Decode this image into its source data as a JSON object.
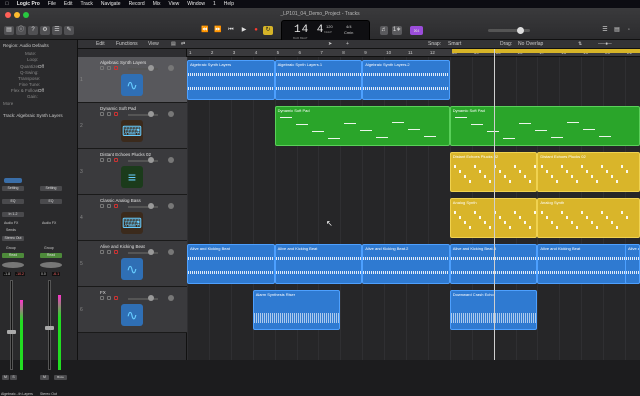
{
  "menubar": {
    "apple": "",
    "app": "Logic Pro",
    "items": [
      "File",
      "Edit",
      "Track",
      "Navigate",
      "Record",
      "Mix",
      "View",
      "Window",
      "1",
      "Help"
    ]
  },
  "window": {
    "title": "_LP101_04_Demo_Project - Tracks"
  },
  "lcd": {
    "position": "14 4",
    "position_label": "BAR  BEAT",
    "tempo": "120",
    "tempo_label": "KEEP",
    "sig": "4/4",
    "key": "Cmin"
  },
  "badge": "☒4",
  "toolbar2": {
    "edit": "Edit",
    "functions": "Functions",
    "view": "View",
    "snap_label": "Snap:",
    "snap": "Smart",
    "drag_label": "Drag:",
    "drag": "No Overlap"
  },
  "ruler": [
    "1",
    "2",
    "3",
    "4",
    "5",
    "6",
    "7",
    "8",
    "9",
    "10",
    "11",
    "12",
    "13",
    "14",
    "15",
    "16",
    "17",
    "18",
    "19",
    "20",
    "21"
  ],
  "inspector": {
    "region": "Region: Audio Defaults",
    "track": "Track: Algebraic Synth Layers",
    "fields": [
      "Mute:",
      "Loop:",
      "Quantize:",
      "Q-Swing:",
      "Transpose:",
      "Fine Tune:",
      "Flex & Follow:",
      "Gain:"
    ],
    "quantize_val": "Off",
    "flex_val": "Off",
    "more": "More"
  },
  "channel": {
    "setting": "Setting",
    "eq": "EQ",
    "input": "In 1-2",
    "audiofx": "Audio FX",
    "sends": "Sends",
    "output": "Stereo Out",
    "group": "Group",
    "read": "Read",
    "vol_left": "-1.8",
    "vol_left2": "-10.2",
    "vol_right": "0.0",
    "vol_right2": "-6.1",
    "name_left": "Algebraic...th Layers",
    "name_right": "Stereo Out",
    "bnce": "Bnce",
    "m": "M",
    "s": "S",
    "r": "R",
    "i": "I"
  },
  "tracks": [
    {
      "num": "1",
      "name": "Algebraic Synth Layers"
    },
    {
      "num": "2",
      "name": "Dynamic Soft Pad"
    },
    {
      "num": "3",
      "name": "Distant Echoes Plucks 02"
    },
    {
      "num": "4",
      "name": "Classic Analog Bass"
    },
    {
      "num": "5",
      "name": "Alive and Kicking Beat"
    },
    {
      "num": "6",
      "name": "FX"
    }
  ],
  "regions": {
    "t1": [
      "Algebraic Synth Layers",
      "Algebraic Synth Layers.1",
      "Algebraic Synth Layers.2"
    ],
    "t2": [
      "Dynamic Soft Pad",
      "Dynamic Soft Pad"
    ],
    "t3": [
      "Distant Echoes Plucks 02",
      "Distant Echoes Plucks 02"
    ],
    "t4": [
      "Analog Synth",
      "Analog Synth"
    ],
    "t5": [
      "Alive and Kicking Beat",
      "Alive and Kicking Beat",
      "Alive and Kicking Beat.2",
      "Alive and Kicking Beat.3",
      "Alive and Kicking Beat",
      "Alive and Kicking Beat"
    ],
    "t6": [
      "Alarm Synthesis Riser",
      "Downward Crash Echo"
    ]
  },
  "colors": {
    "blue": "#2f7ad1",
    "green": "#2aa52a",
    "yellow": "#d9b52a",
    "cycle": "#d6b428"
  }
}
